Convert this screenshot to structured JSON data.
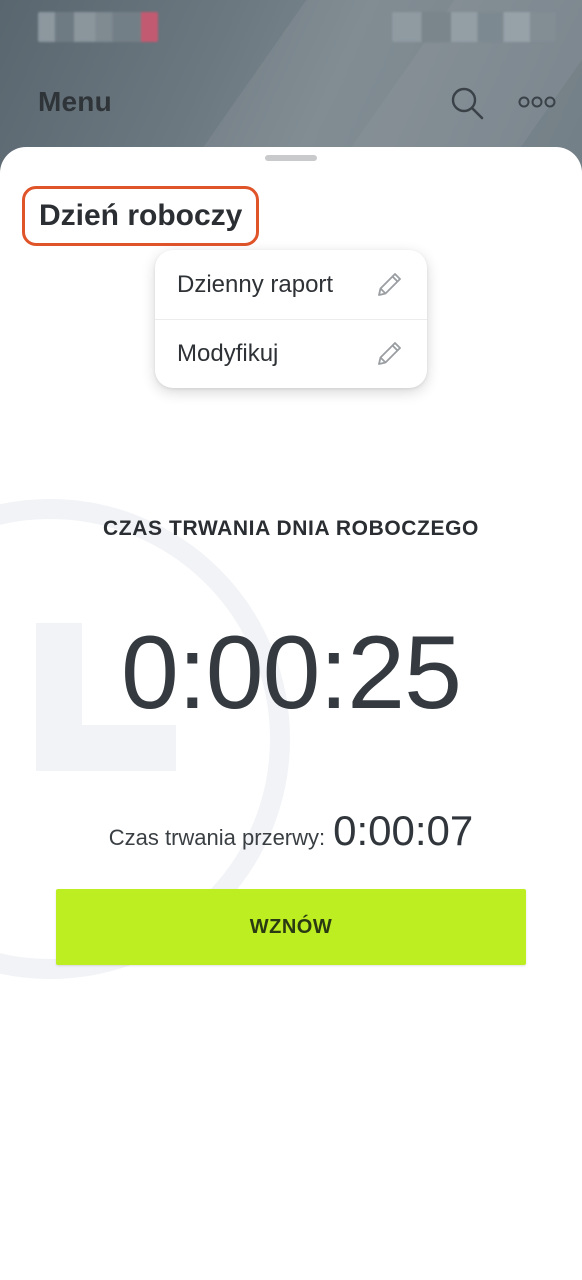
{
  "app": {
    "title": "Menu"
  },
  "sheet": {
    "title": "Dzień roboczy"
  },
  "popup_menu": {
    "items": [
      {
        "label": "Dzienny raport",
        "icon": "pencil-icon"
      },
      {
        "label": "Modyfikuj",
        "icon": "pencil-icon"
      }
    ]
  },
  "timer": {
    "label": "CZAS TRWANIA DNIA ROBOCZEGO",
    "value": "0:00:25",
    "break_label": "Czas trwania przerwy:",
    "break_value": "0:00:07"
  },
  "actions": {
    "resume_label": "WZNÓW"
  },
  "colors": {
    "accent_green": "#bdee22",
    "highlight_border": "#e0542a",
    "header_bg": "#6c7880"
  },
  "icons": {
    "search": "search-icon",
    "more": "more-icon",
    "edit": "pencil-icon"
  }
}
